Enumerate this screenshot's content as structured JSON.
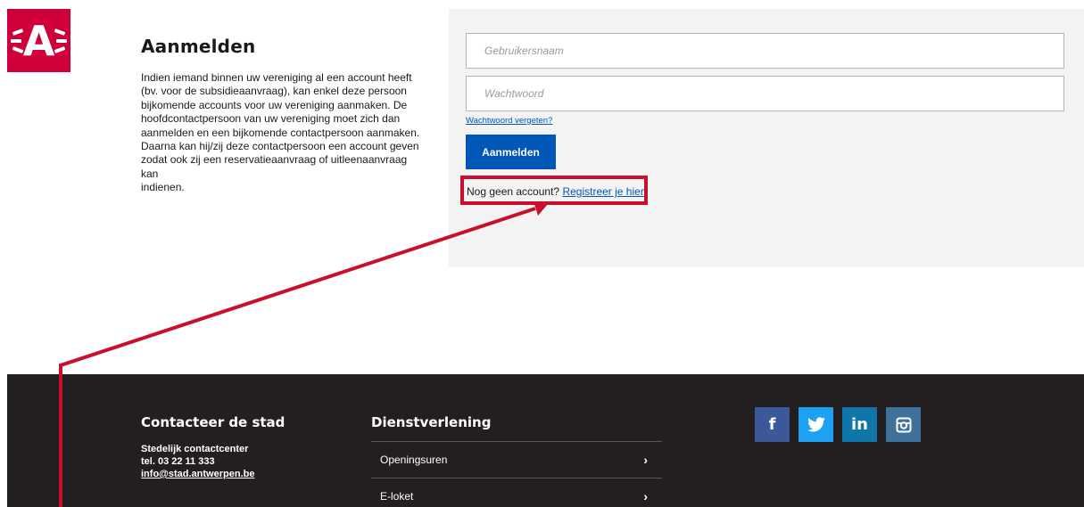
{
  "logo": {
    "letter": "A"
  },
  "intro": {
    "title": "Aanmelden",
    "lines": [
      "Indien iemand binnen uw vereniging al een account heeft",
      "(bv. voor de subsidieaanvraag), kan enkel deze persoon",
      "bijkomende accounts voor uw vereniging aanmaken. De",
      "hoofdcontactpersoon van uw vereniging moet zich dan",
      "aanmelden en een bijkomende contactpersoon aanmaken.",
      "Daarna kan hij/zij deze contactpersoon een account geven",
      "zodat ook zij een reservatieaanvraag of uitleenaanvraag kan",
      "indienen."
    ]
  },
  "login": {
    "username_placeholder": "Gebruikersnaam",
    "password_placeholder": "Wachtwoord",
    "forgot_label": "Wachtwoord vergeten?",
    "submit_label": "Aanmelden",
    "register_prompt": "Nog geen account?",
    "register_link": "Registreer je hier"
  },
  "footer": {
    "contact": {
      "heading": "Contacteer de stad",
      "center": "Stedelijk contactcenter",
      "phone": "tel. 03 22 11 333",
      "email": "info@stad.antwerpen.be"
    },
    "services": {
      "heading": "Dienstverlening",
      "links": [
        {
          "label": "Openingsuren",
          "chevron": "›"
        },
        {
          "label": "E-loket",
          "chevron": "›"
        }
      ]
    },
    "social": [
      {
        "icon": "facebook-icon",
        "glyph": "f"
      },
      {
        "icon": "twitter-icon",
        "glyph": "🐦"
      },
      {
        "icon": "linkedin-icon",
        "glyph": "in"
      },
      {
        "icon": "instagram-icon",
        "glyph": "◙"
      }
    ]
  },
  "colors": {
    "brand_red": "#cf0039",
    "button_blue": "#0057b8",
    "annotation_red": "#c8102e",
    "footer_bg": "#231f20"
  }
}
